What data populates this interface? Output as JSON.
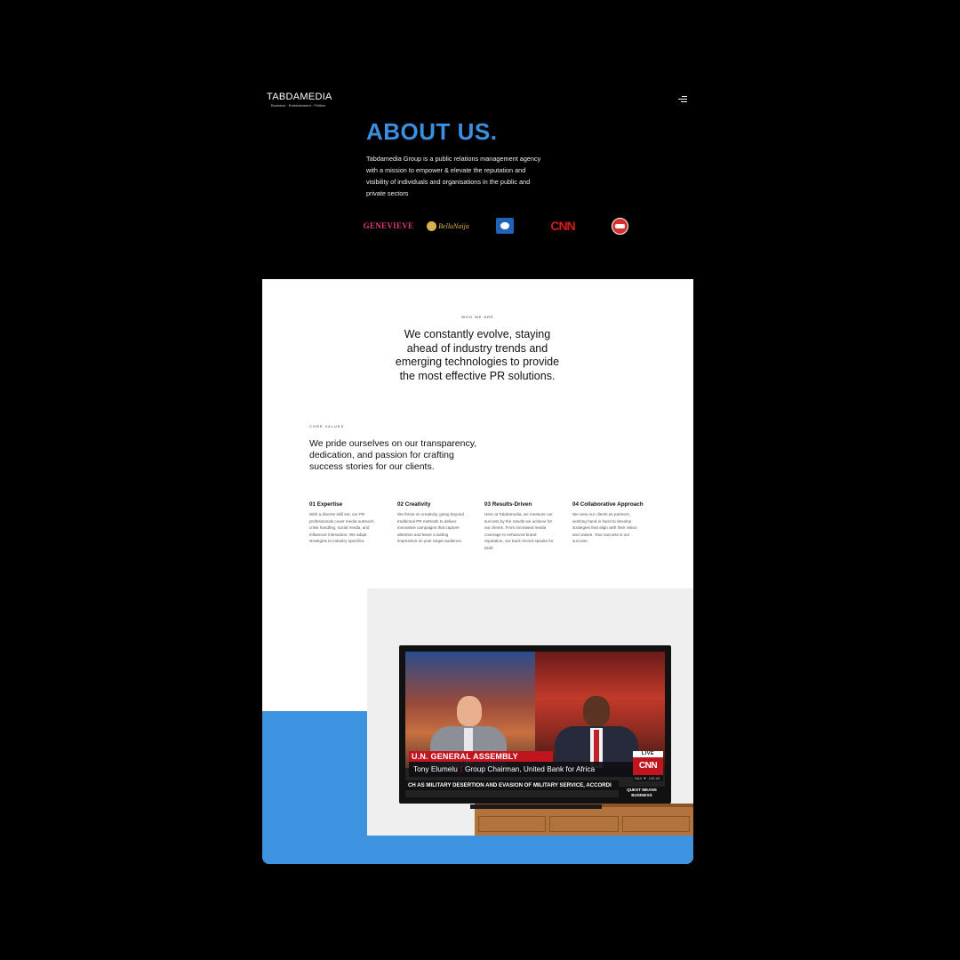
{
  "header": {
    "brand_name": "TABDAMEDIA",
    "brand_tagline": "Business · Entertainment · Politics",
    "menu_icon": "hamburger-menu-icon"
  },
  "hero": {
    "title": "ABOUT US.",
    "description": "Tabdamedia Group is a public relations management agency with a mission to empower & elevate the reputation and visibility of individuals and organisations in the public and private sectors",
    "logos": {
      "genevieve": "GENEVIEVE",
      "bellanaija": "BellaNaija",
      "cnn": "CNN"
    }
  },
  "who_we_are": {
    "label": "WHO WE ARE",
    "heading": "We constantly evolve, staying ahead of industry trends and emerging technologies to provide the most effective PR solutions."
  },
  "core_values": {
    "label": "CORE VALUES",
    "heading": "We pride ourselves on our transparency, dedication, and passion for crafting success stories for our clients.",
    "items": [
      {
        "title": "01 Expertise",
        "desc": "With a diverse skill set, our PR professionals cover media outreach, crisis handling, social media, and influencer interaction. We adapt strategies to industry specifics."
      },
      {
        "title": "02 Creativity",
        "desc": "We thrive on creativity, going beyond traditional PR methods to deliver innovative campaigns that capture attention and leave a lasting impression on your target audience."
      },
      {
        "title": "03 Results-Driven",
        "desc": "Here at Tabdamedia, we measure our success by the results we achieve for our clients. From increased media coverage to enhanced brand reputation, our track record speaks for itself."
      },
      {
        "title": "04 Collaborative Approach",
        "desc": "We view our clients as partners, working hand in hand to develop strategies that align with their vision and values. Your success is our success."
      }
    ]
  },
  "tv": {
    "chyron_title": "U.N. GENERAL ASSEMBLY",
    "chyron_name": "Tony Elumelu",
    "chyron_role": "Group Chairman, United Bank for Africa",
    "ticker": "CH AS MILITARY DESERTION AND EVASION OF MILITARY SERVICE, ACCORDI",
    "live": "LIVE",
    "network": "CNN",
    "index": "DAX  ▼ -132.43",
    "show_line1": "QUEST MEANS",
    "show_line2": "BUSINESS"
  },
  "colors": {
    "accent_blue": "#3b8fe0",
    "background": "#000000",
    "panel": "#ffffff"
  }
}
